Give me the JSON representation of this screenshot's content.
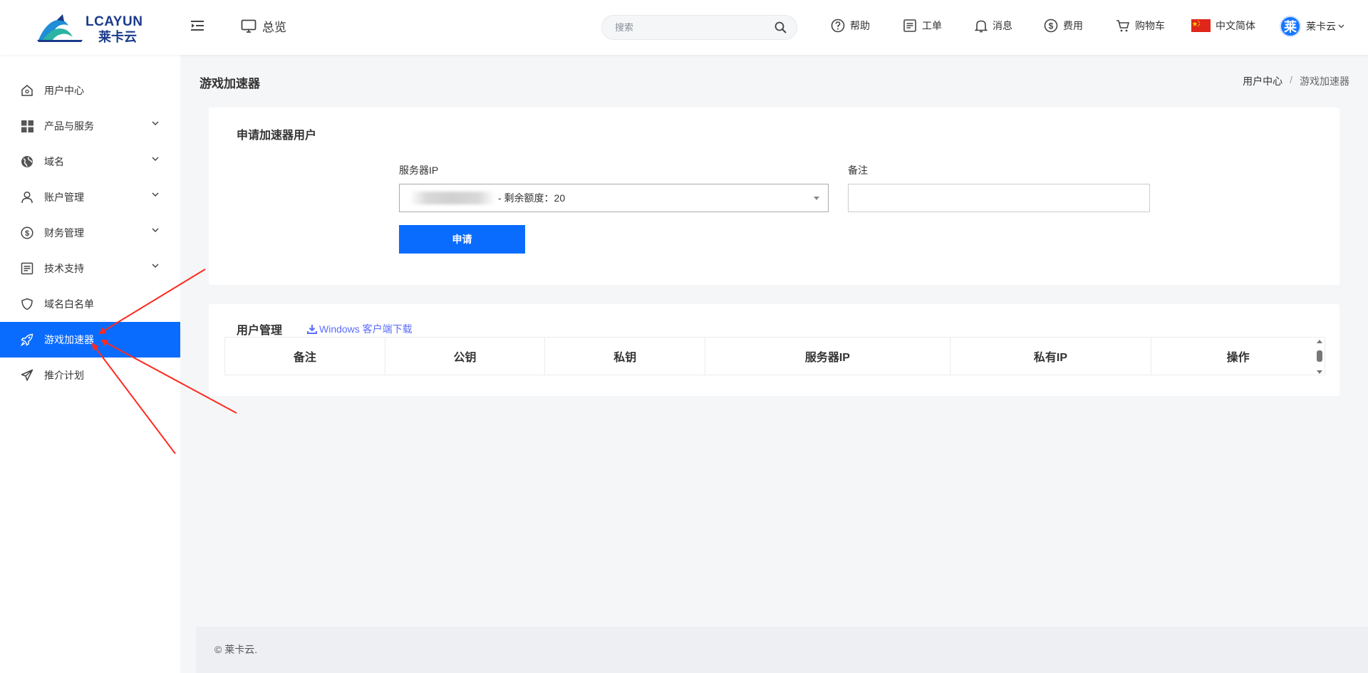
{
  "header": {
    "logo_text": "LCAYUN",
    "logo_sub": "莱卡云",
    "overview_label": "总览",
    "search_placeholder": "搜索",
    "nav": {
      "help": "帮助",
      "ticket": "工单",
      "message": "消息",
      "fee": "费用",
      "cart": "购物车",
      "language": "中文简体",
      "user_initial": "莱",
      "user_name": "莱卡云"
    }
  },
  "sidebar": {
    "items": [
      {
        "label": "用户中心",
        "icon": "home-icon",
        "expandable": false,
        "active": false
      },
      {
        "label": "产品与服务",
        "icon": "grid-icon",
        "expandable": true,
        "active": false
      },
      {
        "label": "域名",
        "icon": "globe-icon",
        "expandable": true,
        "active": false
      },
      {
        "label": "账户管理",
        "icon": "user-icon",
        "expandable": true,
        "active": false
      },
      {
        "label": "财务管理",
        "icon": "dollar-icon",
        "expandable": true,
        "active": false
      },
      {
        "label": "技术支持",
        "icon": "document-icon",
        "expandable": true,
        "active": false
      },
      {
        "label": "域名白名单",
        "icon": "shield-icon",
        "expandable": false,
        "active": false
      },
      {
        "label": "游戏加速器",
        "icon": "rocket-icon",
        "expandable": false,
        "active": true
      },
      {
        "label": "推介计划",
        "icon": "send-icon",
        "expandable": false,
        "active": false
      }
    ]
  },
  "page": {
    "title": "游戏加速器",
    "breadcrumb": [
      "用户中心",
      "游戏加速器"
    ]
  },
  "apply_card": {
    "title": "申请加速器用户",
    "server_ip_label": "服务器IP",
    "server_ip_value": "- 剩余额度：20",
    "remark_label": "备注",
    "remark_value": "",
    "submit_label": "申请"
  },
  "users_card": {
    "title": "用户管理",
    "download_link": "Windows 客户端下载",
    "columns": [
      "备注",
      "公钥",
      "私钥",
      "服务器IP",
      "私有IP",
      "操作"
    ]
  },
  "footer": {
    "copyright": "© 莱卡云."
  },
  "colors": {
    "accent": "#0a6cff",
    "link": "#5b6cff",
    "annotation_arrow": "#ff2a1f"
  }
}
